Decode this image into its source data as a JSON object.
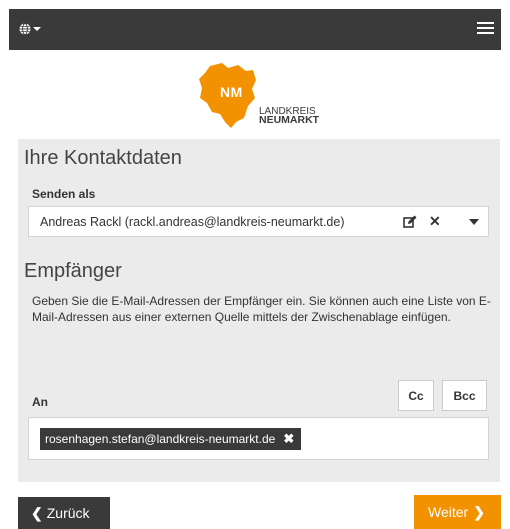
{
  "header": {
    "globe_icon": "globe-icon",
    "menu_icon": "hamburger-icon"
  },
  "logo": {
    "badge": "NM",
    "line1": "LANDKREIS",
    "line2": "NEUMARKT",
    "color": "#f39200"
  },
  "contact": {
    "title": "Ihre Kontaktdaten",
    "send_as_label": "Senden als",
    "send_as_value": "Andreas Rackl (rackl.andreas@landkreis-neumarkt.de)"
  },
  "recipients": {
    "title": "Empfänger",
    "description": "Geben Sie die E-Mail-Adressen der Empfänger ein. Sie können auch eine Liste von E-Mail-Adressen aus einer externen Quelle mittels der Zwischenablage einfügen.",
    "to_label": "An",
    "cc_label": "Cc",
    "bcc_label": "Bcc",
    "chips": [
      "rosenhagen.stefan@landkreis-neumarkt.de"
    ]
  },
  "footer": {
    "back_label": "Zurück",
    "next_label": "Weiter"
  },
  "colors": {
    "accent": "#f39200",
    "dark": "#3a3a3a",
    "panel": "#ebebeb"
  }
}
